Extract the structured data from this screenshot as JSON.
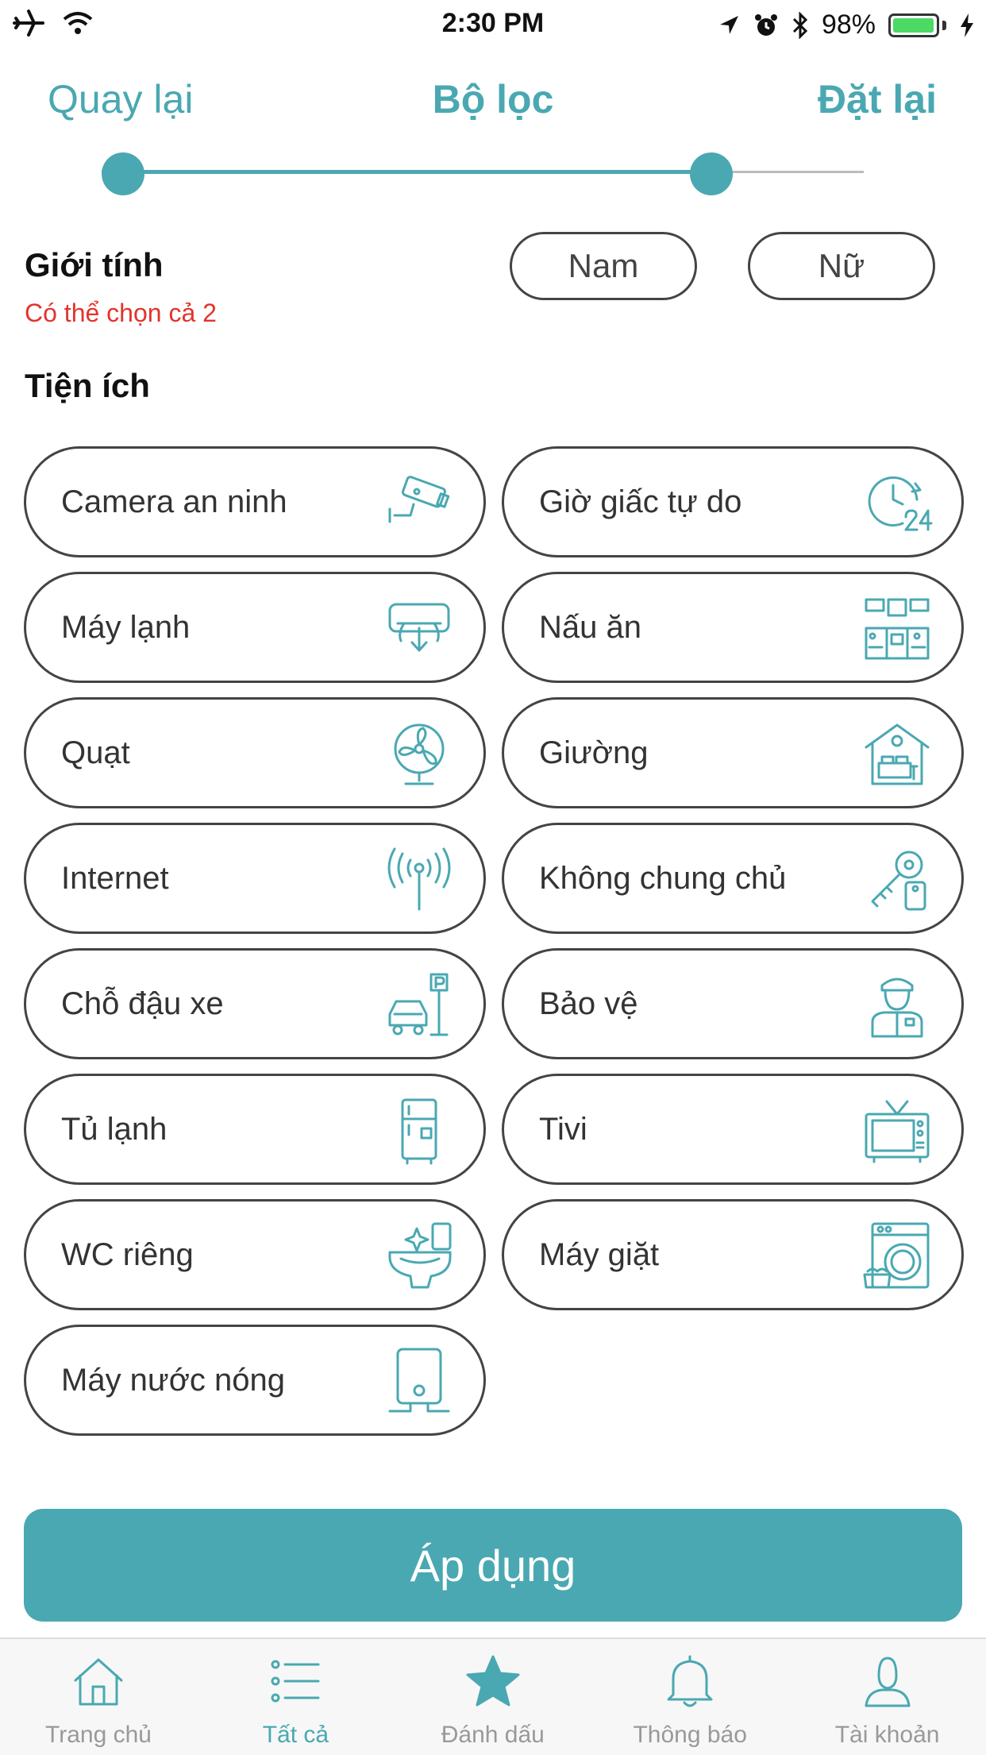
{
  "status_bar": {
    "time": "2:30 PM",
    "battery": "98%",
    "battery_level": 0.98
  },
  "header": {
    "back_label": "Quay lại",
    "title": "Bộ lọc",
    "reset_label": "Đặt lại"
  },
  "price_slider": {
    "low": 0.0,
    "high": 0.8
  },
  "gender": {
    "title": "Giới tính",
    "hint": "Có thể chọn cả 2",
    "options": [
      "Nam",
      "Nữ"
    ]
  },
  "amenities": {
    "title": "Tiện ích",
    "items": [
      {
        "label": "Camera an ninh",
        "icon": "security-camera-icon"
      },
      {
        "label": "Giờ giấc tự do",
        "icon": "clock-24-icon"
      },
      {
        "label": "Máy lạnh",
        "icon": "air-conditioner-icon"
      },
      {
        "label": "Nấu ăn",
        "icon": "kitchen-icon"
      },
      {
        "label": "Quạt",
        "icon": "fan-icon"
      },
      {
        "label": "Giường",
        "icon": "bed-icon"
      },
      {
        "label": "Internet",
        "icon": "wifi-antenna-icon"
      },
      {
        "label": "Không chung chủ",
        "icon": "keys-icon"
      },
      {
        "label": "Chỗ đậu xe",
        "icon": "parking-icon"
      },
      {
        "label": "Bảo vệ",
        "icon": "security-guard-icon"
      },
      {
        "label": "Tủ lạnh",
        "icon": "fridge-icon"
      },
      {
        "label": "Tivi",
        "icon": "tv-icon"
      },
      {
        "label": "WC riêng",
        "icon": "toilet-icon"
      },
      {
        "label": "Máy giặt",
        "icon": "washing-machine-icon"
      },
      {
        "label": "Máy nước nóng",
        "icon": "water-heater-icon"
      }
    ]
  },
  "apply_label": "Áp dụng",
  "tabs": [
    {
      "label": "Trang chủ",
      "icon": "home-icon",
      "active": false
    },
    {
      "label": "Tất cả",
      "icon": "list-icon",
      "active": true
    },
    {
      "label": "Đánh dấu",
      "icon": "star-icon",
      "active": false
    },
    {
      "label": "Thông báo",
      "icon": "bell-icon",
      "active": false
    },
    {
      "label": "Tài khoản",
      "icon": "user-icon",
      "active": false
    }
  ],
  "colors": {
    "accent": "#4aa8b2",
    "hint": "#e2342c",
    "border": "#444444"
  }
}
